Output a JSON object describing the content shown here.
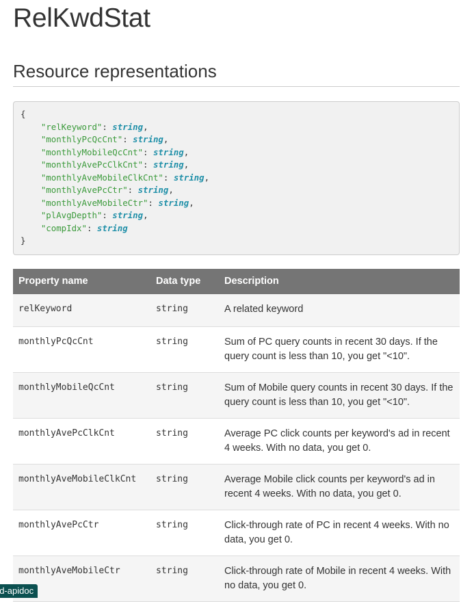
{
  "page_title": "RelKwdStat",
  "section_title": "Resource representations",
  "code": {
    "open_brace": "{",
    "close_brace": "}",
    "fields": [
      {
        "key": "\"relKeyword\"",
        "type": "string",
        "comma": true
      },
      {
        "key": "\"monthlyPcQcCnt\"",
        "type": "string",
        "comma": true
      },
      {
        "key": "\"monthlyMobileQcCnt\"",
        "type": "string",
        "comma": true
      },
      {
        "key": "\"monthlyAvePcClkCnt\"",
        "type": "string",
        "comma": true
      },
      {
        "key": "\"monthlyAveMobileClkCnt\"",
        "type": "string",
        "comma": true
      },
      {
        "key": "\"monthlyAvePcCtr\"",
        "type": "string",
        "comma": true
      },
      {
        "key": "\"monthlyAveMobileCtr\"",
        "type": "string",
        "comma": true
      },
      {
        "key": "\"plAvgDepth\"",
        "type": "string",
        "comma": true
      },
      {
        "key": "\"compIdx\"",
        "type": "string",
        "comma": false
      }
    ]
  },
  "table": {
    "headers": [
      "Property name",
      "Data type",
      "Description"
    ],
    "rows": [
      {
        "name": "relKeyword",
        "type": "string",
        "desc": "A related keyword"
      },
      {
        "name": "monthlyPcQcCnt",
        "type": "string",
        "desc": "Sum of PC query counts in recent 30 days. If the query count is less than 10, you get \"<10\"."
      },
      {
        "name": "monthlyMobileQcCnt",
        "type": "string",
        "desc": "Sum of Mobile query counts in recent 30 days. If the query count is less than 10, you get \"<10\"."
      },
      {
        "name": "monthlyAvePcClkCnt",
        "type": "string",
        "desc": "Average PC click counts per keyword's ad in recent 4 weeks. With no data, you get 0."
      },
      {
        "name": "monthlyAveMobileClkCnt",
        "type": "string",
        "desc": "Average Mobile click counts per keyword's ad in recent 4 weeks. With no data, you get 0."
      },
      {
        "name": "monthlyAvePcCtr",
        "type": "string",
        "desc": "Click-through rate of PC in recent 4 weeks. With no data, you get 0."
      },
      {
        "name": "monthlyAveMobileCtr",
        "type": "string",
        "desc": "Click-through rate of Mobile in recent 4 weeks. With no data, you get 0."
      }
    ]
  },
  "badge": {
    "label": "ad-apidoc"
  }
}
